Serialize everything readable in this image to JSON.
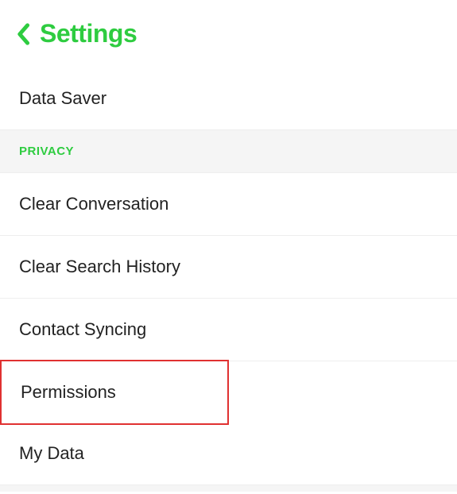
{
  "header": {
    "title": "Settings"
  },
  "rows": {
    "data_saver": "Data Saver",
    "privacy_header": "PRIVACY",
    "clear_conversation": "Clear Conversation",
    "clear_search_history": "Clear Search History",
    "contact_syncing": "Contact Syncing",
    "permissions": "Permissions",
    "my_data": "My Data"
  },
  "colors": {
    "accent": "#2ecc40",
    "highlight_border": "#e03131"
  }
}
